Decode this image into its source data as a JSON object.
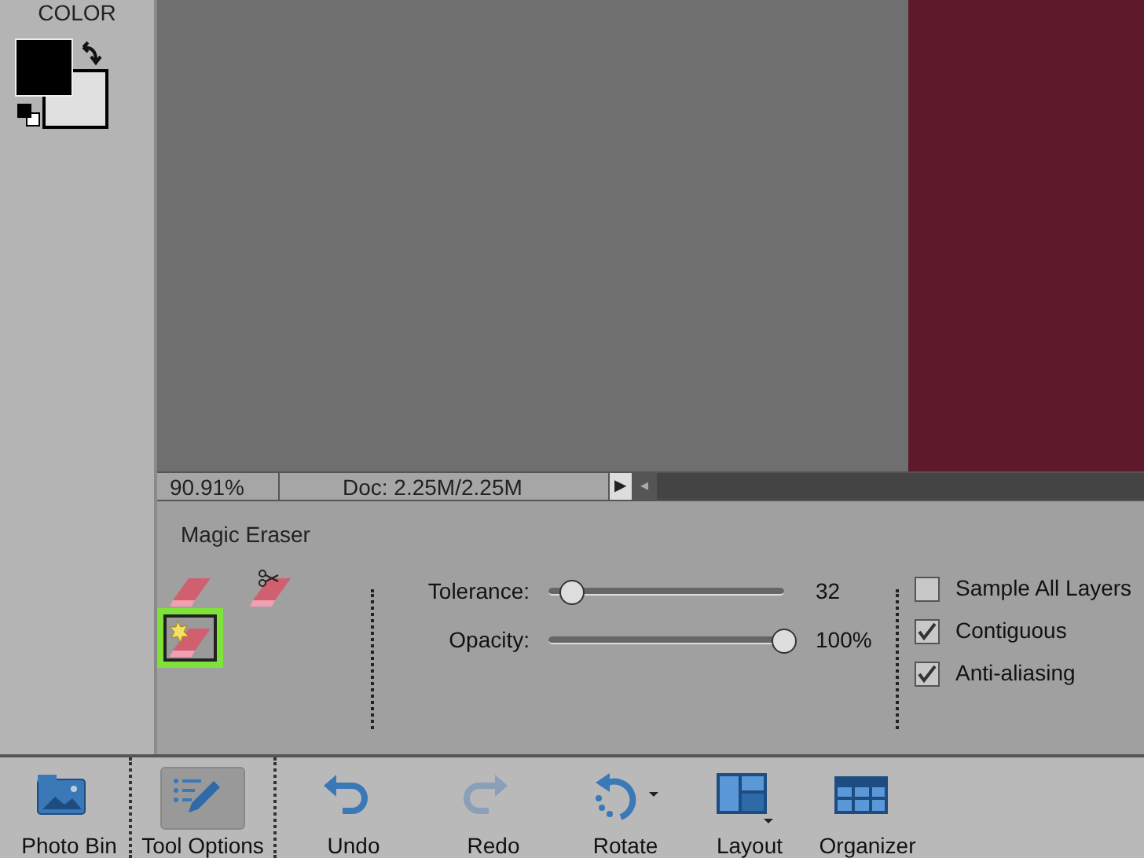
{
  "color_panel": {
    "title": "COLOR"
  },
  "status_bar": {
    "zoom": "90.91%",
    "doc": "Doc: 2.25M/2.25M",
    "arrow": "▶",
    "scroll_left": "◂"
  },
  "tool_options": {
    "title": "Magic Eraser",
    "tools": [
      {
        "kind": "eraser",
        "selected": false
      },
      {
        "kind": "background",
        "selected": false
      },
      {
        "kind": "magic",
        "selected": true
      }
    ],
    "sliders": [
      {
        "label": "Tolerance:",
        "level": 0.1,
        "reading": "32"
      },
      {
        "label": "Opacity:",
        "level": 1.0,
        "reading": "100%"
      }
    ],
    "checkboxes": [
      {
        "label": "Sample All Layers",
        "checked": false
      },
      {
        "label": "Contiguous",
        "checked": true
      },
      {
        "label": "Anti-aliasing",
        "checked": true
      }
    ]
  },
  "taskbar": [
    {
      "kind": "photo",
      "label": "Photo Bin",
      "selected": false
    },
    {
      "kind": "options",
      "label": "Tool Options",
      "selected": true
    },
    {
      "kind": "undo",
      "label": "Undo",
      "selected": false
    },
    {
      "kind": "redo",
      "label": "Redo",
      "selected": false
    },
    {
      "kind": "rotate",
      "label": "Rotate",
      "selected": false
    },
    {
      "kind": "layout",
      "label": "Layout",
      "selected": false
    },
    {
      "kind": "organizer",
      "label": "Organizer",
      "selected": false
    }
  ]
}
